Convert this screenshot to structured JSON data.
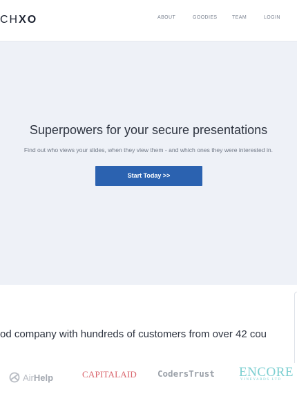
{
  "header": {
    "logo_thin": "CH",
    "logo_bold": "XO",
    "nav": {
      "about": "ABOUT",
      "goodies": "GOODIES",
      "team": "TEAM",
      "login": "LOGIN"
    }
  },
  "hero": {
    "title": "Superpowers for your secure presentations",
    "subtitle": "Find out who views your slides, when they view them - and which ones they were interested in.",
    "cta_label": "Start Today >>"
  },
  "customers": {
    "text": "od company with hundreds of customers from over 42 cou",
    "logos": {
      "airhelp_light": "Air",
      "airhelp_bold": "Help",
      "capitalaid": "CAPITALAID",
      "coderstrust": "CodersTrust",
      "encore_name": "ENCORE",
      "encore_sub": "VINEYARDS LTD"
    }
  },
  "colors": {
    "accent": "#2b62b0",
    "hero_bg": "#eef1f7",
    "capitalaid": "#d9626a",
    "encore": "#7ccfd1"
  }
}
